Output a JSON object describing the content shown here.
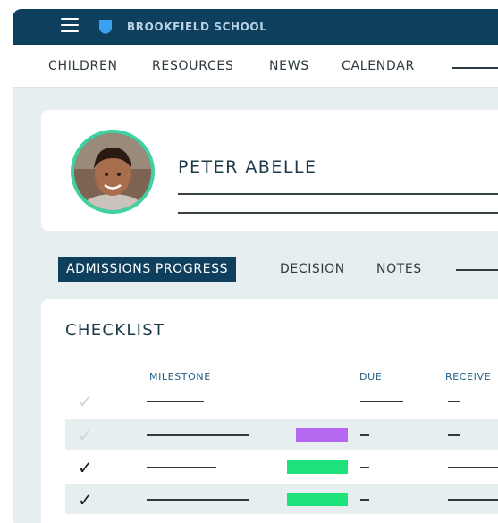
{
  "header": {
    "brand": "BROOKFIELD SCHOOL",
    "menu_icon": "hamburger-menu-icon",
    "logo_icon": "shield-logo-icon",
    "color": "#0e3f5c"
  },
  "nav": {
    "items": [
      {
        "label": "CHILDREN"
      },
      {
        "label": "RESOURCES"
      },
      {
        "label": "NEWS"
      },
      {
        "label": "CALENDAR"
      }
    ]
  },
  "profile": {
    "name": "PETER ABELLE",
    "ring_color": "#3fd1a0"
  },
  "tabs": {
    "items": [
      {
        "label": "ADMISSIONS PROGRESS",
        "active": true
      },
      {
        "label": "DECISION",
        "active": false
      },
      {
        "label": "NOTES",
        "active": false
      }
    ]
  },
  "checklist": {
    "title": "CHECKLIST",
    "columns": {
      "milestone": "MILESTONE",
      "due": "DUE",
      "received": "RECEIVE"
    },
    "dash": "–",
    "rows": [
      {
        "checked": false,
        "status_color": ""
      },
      {
        "checked": false,
        "status_color": "#b567f0"
      },
      {
        "checked": true,
        "status_color": "#1ee37d"
      },
      {
        "checked": true,
        "status_color": "#1ee37d"
      },
      {
        "checked": false,
        "status_color": "#b567f0"
      }
    ]
  }
}
